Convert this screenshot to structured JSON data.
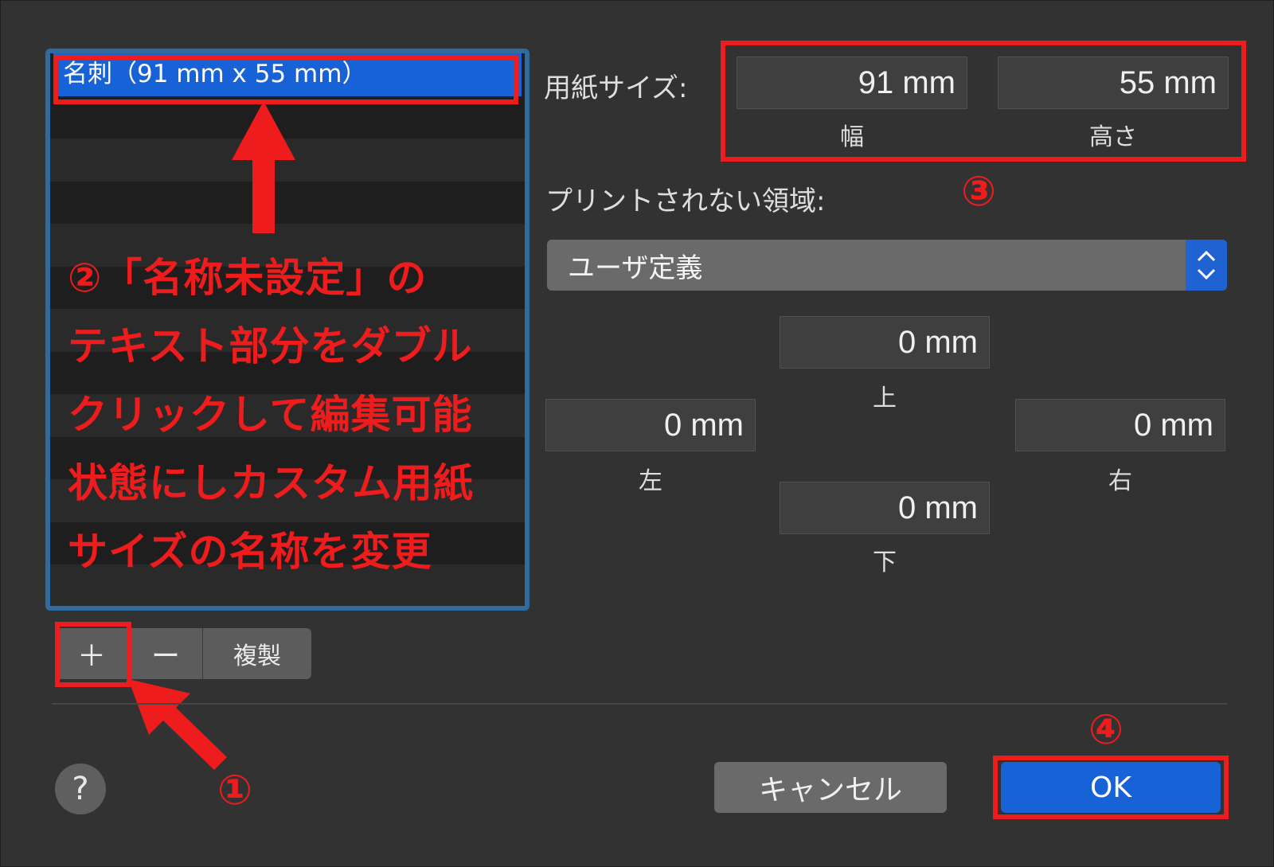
{
  "list": {
    "selected_item": "名刺（91 mm x 55 mm）",
    "row_count": 13
  },
  "buttons": {
    "add_label": "＋",
    "remove_label": "ー",
    "duplicate_label": "複製",
    "cancel_label": "キャンセル",
    "ok_label": "OK",
    "help_label": "?"
  },
  "paper_size": {
    "label": "用紙サイズ:",
    "width_value": "91 mm",
    "width_label": "幅",
    "height_value": "55 mm",
    "height_label": "高さ"
  },
  "margins": {
    "label": "プリントされない領域:",
    "preset": "ユーザ定義",
    "top_value": "0 mm",
    "top_label": "上",
    "left_value": "0 mm",
    "left_label": "左",
    "right_value": "0 mm",
    "right_label": "右",
    "bottom_value": "0 mm",
    "bottom_label": "下"
  },
  "annotations": {
    "step1": "①",
    "step2_lines": [
      "②「名称未設定」の",
      "テキスト部分をダブル",
      "クリックして編集可能",
      "状態にしカスタム用紙",
      "サイズの名称を変更"
    ],
    "step3": "③",
    "step4": "④"
  },
  "colors": {
    "annotation_red": "#ee1c1c",
    "accent_blue": "#1662d6",
    "list_border": "#2f6b9f"
  }
}
